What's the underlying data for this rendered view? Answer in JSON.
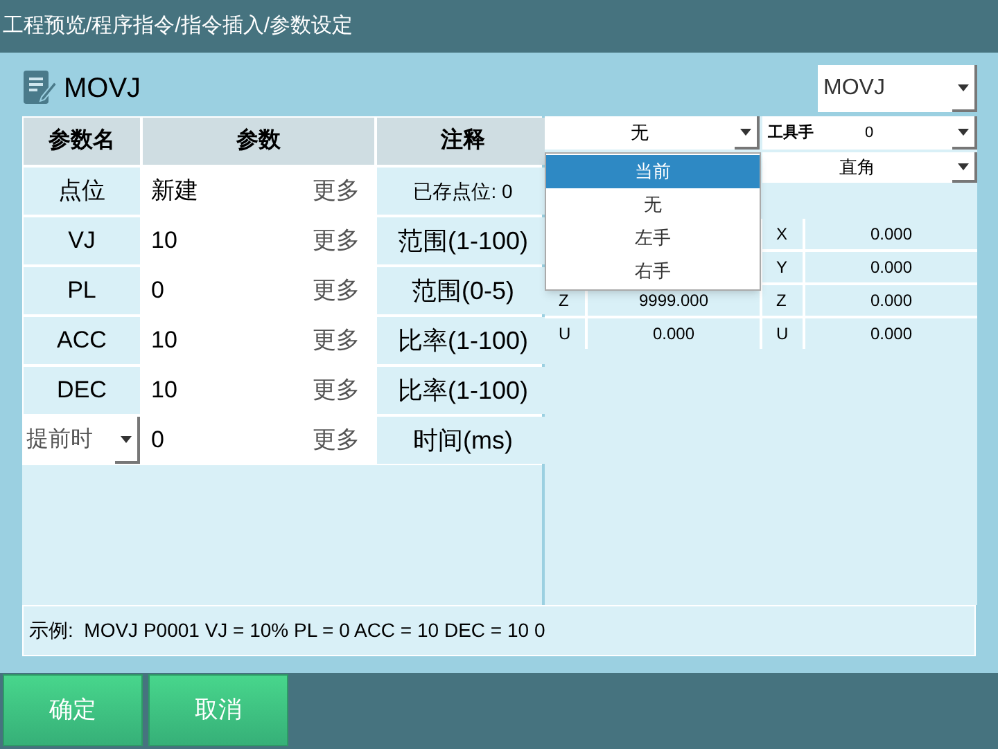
{
  "title": "工程预览/程序指令/指令插入/参数设定",
  "command": {
    "name": "MOVJ",
    "selector": "MOVJ"
  },
  "table": {
    "columns": [
      "参数名",
      "参数",
      "注释"
    ],
    "rows": [
      {
        "kind": "label",
        "name": "点位",
        "value": "新建",
        "more": "更多",
        "note": "已存点位: 0"
      },
      {
        "kind": "label",
        "name": "VJ",
        "value": "10",
        "more": "更多",
        "note": "范围(1-100)"
      },
      {
        "kind": "label",
        "name": "PL",
        "value": "0",
        "more": "更多",
        "note": "范围(0-5)"
      },
      {
        "kind": "label",
        "name": "ACC",
        "value": "10",
        "more": "更多",
        "note": "比率(1-100)"
      },
      {
        "kind": "label",
        "name": "DEC",
        "value": "10",
        "more": "更多",
        "note": "比率(1-100)"
      },
      {
        "kind": "dropdown",
        "name": "提前时",
        "value": "0",
        "more": "更多",
        "note": "时间(ms)"
      }
    ]
  },
  "hand_select": {
    "value": "无",
    "options": [
      {
        "label": "当前",
        "highlighted": true
      },
      {
        "label": "无",
        "highlighted": false
      },
      {
        "label": "左手",
        "highlighted": false
      },
      {
        "label": "右手",
        "highlighted": false
      }
    ]
  },
  "tool": {
    "label": "工具手",
    "value": "0"
  },
  "coord_select": {
    "value": "直角"
  },
  "coords_left": [
    {
      "axis": "Z",
      "value": "9999.000"
    },
    {
      "axis": "U",
      "value": "0.000"
    }
  ],
  "coords_right": [
    {
      "axis": "X",
      "value": "0.000"
    },
    {
      "axis": "Y",
      "value": "0.000"
    },
    {
      "axis": "Z",
      "value": "0.000"
    },
    {
      "axis": "U",
      "value": "0.000"
    }
  ],
  "example": "示例:  MOVJ P0001 VJ = 10% PL = 0 ACC = 10 DEC = 10 0",
  "buttons": [
    "确定",
    "取消"
  ]
}
